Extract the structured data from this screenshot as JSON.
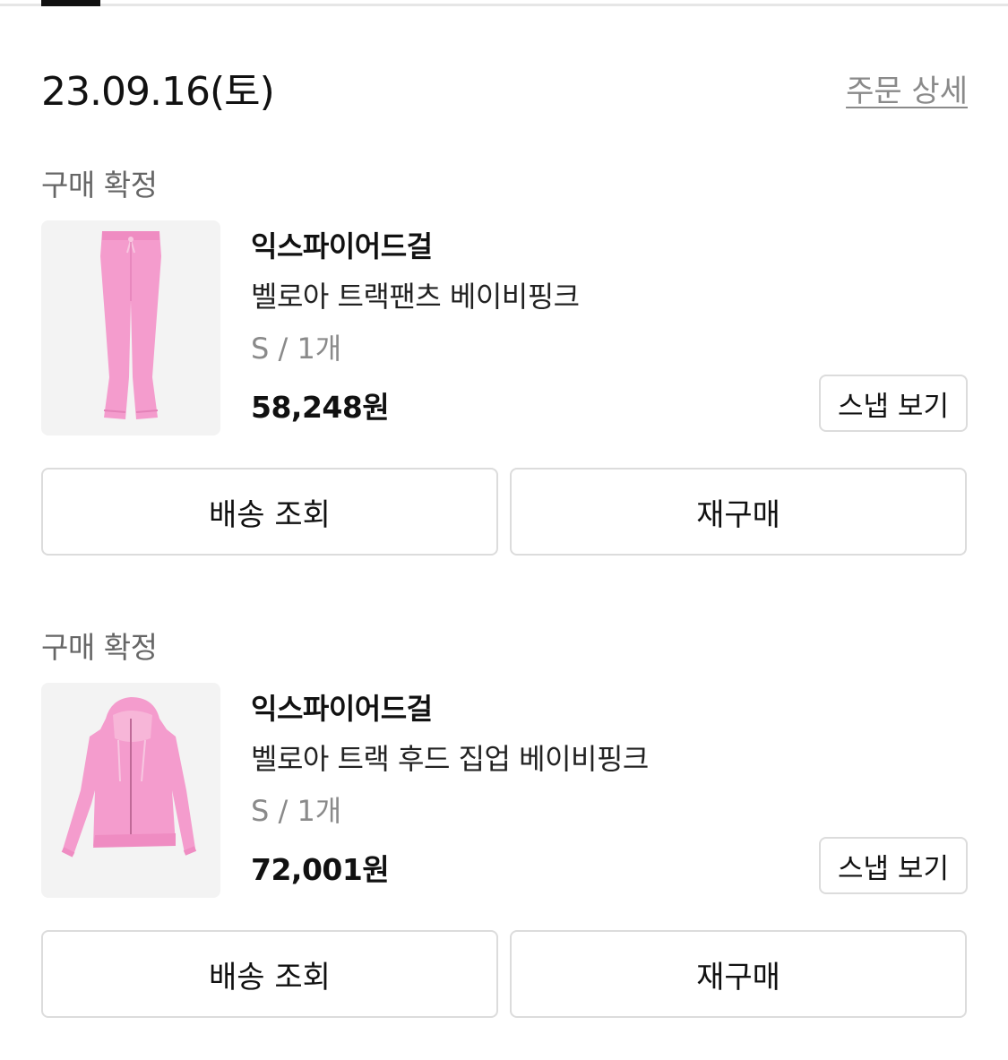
{
  "order": {
    "date": "23.09.16(토)",
    "detail_link": "주문 상세"
  },
  "items": [
    {
      "status": "구매 확정",
      "image_icon": "pink-track-pants",
      "brand": "익스파이어드걸",
      "name": "벨로아 트랙팬츠 베이비핑크",
      "option": "S / 1개",
      "price": "58,248원",
      "snap_label": "스냅 보기",
      "delivery_label": "배송 조회",
      "rebuy_label": "재구매"
    },
    {
      "status": "구매 확정",
      "image_icon": "pink-zip-up-hoodie",
      "brand": "익스파이어드걸",
      "name": "벨로아 트랙 후드 집업 베이비핑크",
      "option": "S / 1개",
      "price": "72,001원",
      "snap_label": "스냅 보기",
      "delivery_label": "배송 조회",
      "rebuy_label": "재구매"
    }
  ],
  "colors": {
    "product_pink": "#f49ccd",
    "thumb_bg": "#f3f3f3",
    "border": "#dcdcdc"
  }
}
